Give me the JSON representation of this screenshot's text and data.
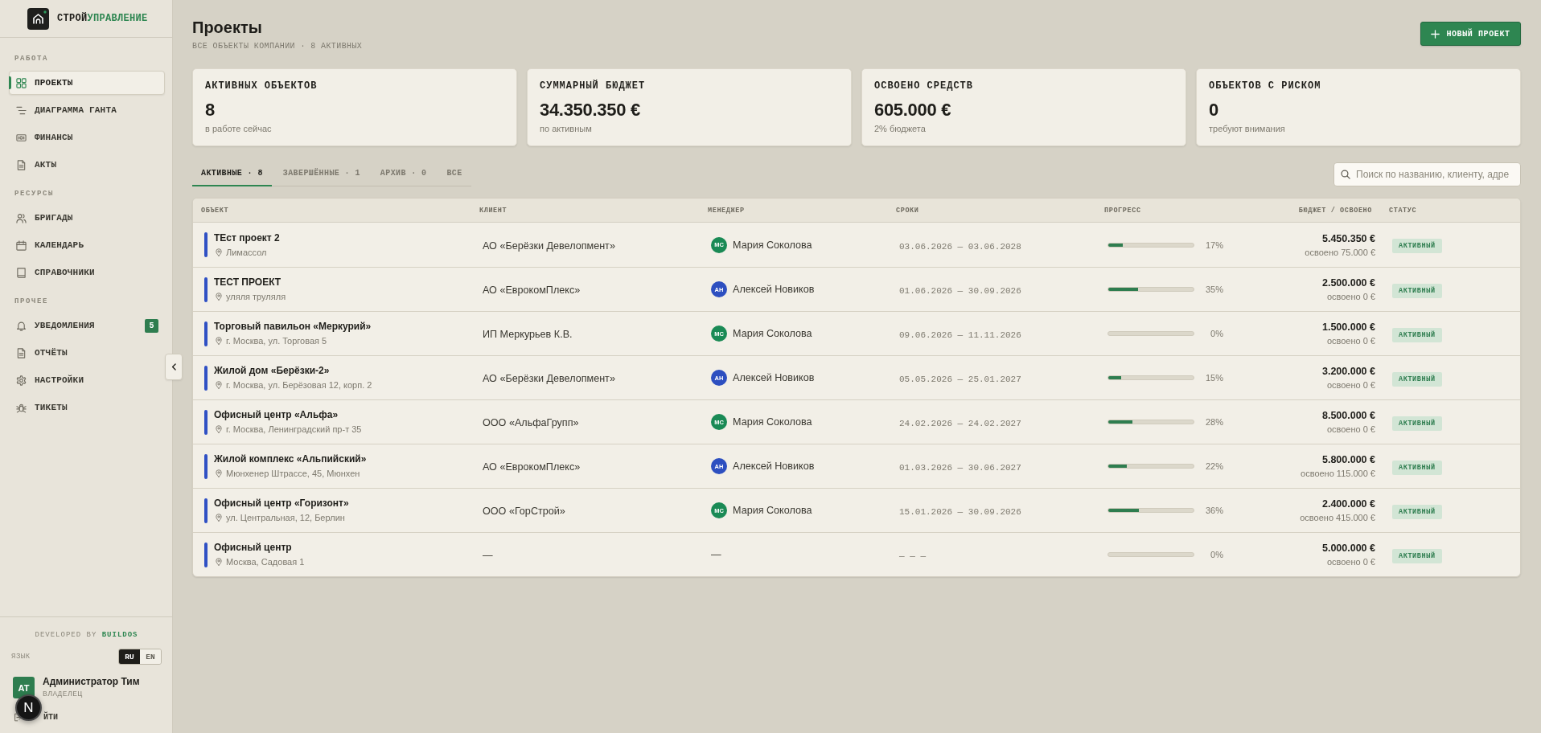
{
  "sidebar": {
    "logo": {
      "name": "СТРОЙ",
      "accent": "УПРАВЛЕНИЕ"
    },
    "sections": [
      {
        "title": "РАБОТА",
        "items": [
          {
            "label": "ПРОЕКТЫ",
            "selected": true
          },
          {
            "label": "ДИАГРАММА ГАНТА",
            "selected": false
          },
          {
            "label": "ФИНАНСЫ",
            "selected": false
          },
          {
            "label": "АКТЫ",
            "selected": false
          }
        ]
      },
      {
        "title": "РЕСУРСЫ",
        "items": [
          {
            "label": "БРИГАДЫ",
            "selected": false
          },
          {
            "label": "КАЛЕНДАРЬ",
            "selected": false
          },
          {
            "label": "СПРАВОЧНИКИ",
            "selected": false
          }
        ]
      },
      {
        "title": "ПРОЧЕЕ",
        "items": [
          {
            "label": "УВЕДОМЛЕНИЯ",
            "selected": false,
            "badge": "5"
          },
          {
            "label": "ОТЧЁТЫ",
            "selected": false
          },
          {
            "label": "НАСТРОЙКИ",
            "selected": false
          },
          {
            "label": "ТИКЕТЫ",
            "selected": false
          }
        ]
      }
    ],
    "credit": "DEVELOPED BY **BUILDOS**",
    "language": {
      "label": "ЯЗЫК",
      "options": [
        {
          "label": "RU",
          "selected": true
        },
        {
          "label": "EN",
          "selected": false
        }
      ]
    },
    "user": {
      "initials": "АТ",
      "name": "Администратор Тим",
      "role": "ВЛАДЕЛЕЦ"
    },
    "logout": "ЙТИ"
  },
  "dev_indicator": {
    "label": "N"
  },
  "header": {
    "title": "Проекты",
    "subtitle": "ВСЕ ОБЪЕКТЫ КОМПАНИИ · 8 АКТИВНЫХ",
    "new_button": "НОВЫЙ ПРОЕКТ"
  },
  "stats": [
    {
      "label": "АКТИВНЫХ ОБЪЕКТОВ",
      "value": "8",
      "note": "в работе сейчас"
    },
    {
      "label": "СУММАРНЫЙ БЮДЖЕТ",
      "value": "34.350.350 €",
      "note": "по активным"
    },
    {
      "label": "ОСВОЕНО СРЕДСТВ",
      "value": "605.000 €",
      "note": "2% бюджета"
    },
    {
      "label": "ОБЪЕКТОВ С РИСКОМ",
      "value": "0",
      "note": "требуют внимания"
    }
  ],
  "tabs": [
    {
      "label": "АКТИВНЫЕ · 8",
      "selected": true
    },
    {
      "label": "ЗАВЕРШЁННЫЕ · 1",
      "selected": false
    },
    {
      "label": "АРХИВ · 0",
      "selected": false
    },
    {
      "label": "ВСЕ",
      "selected": false
    }
  ],
  "search": {
    "placeholder": "Поиск по названию, клиенту, адре"
  },
  "table": {
    "columns": [
      "ОБЪЕКТ",
      "КЛИЕНТ",
      "МЕНЕДЖЕР",
      "СРОКИ",
      "ПРОГРЕСС",
      "БЮДЖЕТ / ОСВОЕНО",
      "СТАТУС"
    ],
    "rows": [
      {
        "name": "ТЕст проект 2",
        "address": "Лимассол",
        "client": "АО «Берёзки Девелопмент»",
        "manager": {
          "initials": "МС",
          "name": "Мария Соколова",
          "color": "#1a8a55"
        },
        "dates": "03.06.2026 — 03.06.2028",
        "progress": {
          "level": 0.17,
          "reading": "17%"
        },
        "budget": "5.450.350 €",
        "spent": "освоено 75.000 €",
        "status": "АКТИВНЫЙ"
      },
      {
        "name": "ТЕСТ ПРОЕКТ",
        "address": "уляля труляля",
        "client": "АО «ЕврокомПлекс»",
        "manager": {
          "initials": "АН",
          "name": "Алексей Новиков",
          "color": "#2d4fc0"
        },
        "dates": "01.06.2026 — 30.09.2026",
        "progress": {
          "level": 0.35,
          "reading": "35%"
        },
        "budget": "2.500.000 €",
        "spent": "освоено 0 €",
        "status": "АКТИВНЫЙ"
      },
      {
        "name": "Торговый павильон «Меркурий»",
        "address": "г. Москва, ул. Торговая 5",
        "client": "ИП Меркурьев К.В.",
        "manager": {
          "initials": "МС",
          "name": "Мария Соколова",
          "color": "#1a8a55"
        },
        "dates": "09.06.2026 — 11.11.2026",
        "progress": {
          "level": 0,
          "reading": "0%"
        },
        "budget": "1.500.000 €",
        "spent": "освоено 0 €",
        "status": "АКТИВНЫЙ"
      },
      {
        "name": "Жилой дом «Берёзки-2»",
        "address": "г. Москва, ул. Берёзовая 12, корп. 2",
        "client": "АО «Берёзки Девелопмент»",
        "manager": {
          "initials": "АН",
          "name": "Алексей Новиков",
          "color": "#2d4fc0"
        },
        "dates": "05.05.2026 — 25.01.2027",
        "progress": {
          "level": 0.15,
          "reading": "15%"
        },
        "budget": "3.200.000 €",
        "spent": "освоено 0 €",
        "status": "АКТИВНЫЙ"
      },
      {
        "name": "Офисный центр «Альфа»",
        "address": "г. Москва, Ленинградский пр-т 35",
        "client": "ООО «АльфаГрупп»",
        "manager": {
          "initials": "МС",
          "name": "Мария Соколова",
          "color": "#1a8a55"
        },
        "dates": "24.02.2026 — 24.02.2027",
        "progress": {
          "level": 0.28,
          "reading": "28%"
        },
        "budget": "8.500.000 €",
        "spent": "освоено 0 €",
        "status": "АКТИВНЫЙ"
      },
      {
        "name": "Жилой комплекс «Альпийский»",
        "address": "Мюнхенер Штрассе, 45, Мюнхен",
        "client": "АО «ЕврокомПлекс»",
        "manager": {
          "initials": "АН",
          "name": "Алексей Новиков",
          "color": "#2d4fc0"
        },
        "dates": "01.03.2026 — 30.06.2027",
        "progress": {
          "level": 0.22,
          "reading": "22%"
        },
        "budget": "5.800.000 €",
        "spent": "освоено 115.000 €",
        "status": "АКТИВНЫЙ"
      },
      {
        "name": "Офисный центр «Горизонт»",
        "address": "ул. Центральная, 12, Берлин",
        "client": "ООО «ГорСтрой»",
        "manager": {
          "initials": "МС",
          "name": "Мария Соколова",
          "color": "#1a8a55"
        },
        "dates": "15.01.2026 — 30.09.2026",
        "progress": {
          "level": 0.36,
          "reading": "36%"
        },
        "budget": "2.400.000 €",
        "spent": "освоено 415.000 €",
        "status": "АКТИВНЫЙ"
      },
      {
        "name": "Офисный центр",
        "address": "Москва, Садовая 1",
        "client": "—",
        "manager": {
          "name": "—"
        },
        "dates": "— — —",
        "progress": {
          "level": 0,
          "reading": "0%"
        },
        "budget": "5.000.000 €",
        "spent": "освоено 0 €",
        "status": "АКТИВНЫЙ"
      }
    ]
  }
}
